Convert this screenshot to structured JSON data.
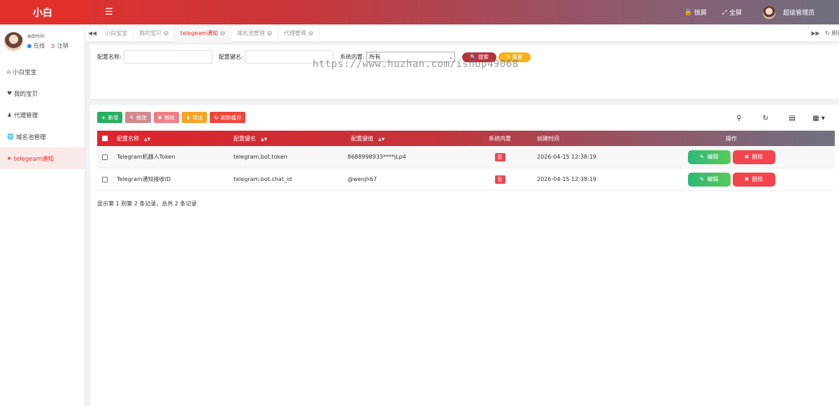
{
  "topbar": {
    "logo": "小白",
    "menu_icon": "hamburger-icon",
    "lock_label": "锁屏",
    "fullscreen_label": "全屏",
    "user_label": "超级管理员"
  },
  "sidebar": {
    "username": "admin",
    "status_online": "在线",
    "status_logout": "注销",
    "items": [
      {
        "label": "小白宝宝",
        "icon": "home-icon"
      },
      {
        "label": "我的宝贝",
        "icon": "heart-icon"
      },
      {
        "label": "代理管理",
        "icon": "user-icon"
      },
      {
        "label": "域名池管理",
        "icon": "globe-icon"
      },
      {
        "label": "telegeam通知",
        "icon": "arrow-circle-icon"
      }
    ]
  },
  "tabs": {
    "items": [
      {
        "label": "小白宝宝"
      },
      {
        "label": "我的宝贝"
      },
      {
        "label": "telegeam通知"
      },
      {
        "label": "域名池管理"
      },
      {
        "label": "代理管理"
      }
    ],
    "refresh_label": "刷新"
  },
  "search": {
    "name_label": "配置名称:",
    "key_label": "配置键名:",
    "sys_label": "系统内置:",
    "sys_value": "所有",
    "search_btn": "搜索",
    "reset_btn": "重置",
    "watermark": "https://www.huzhan.com/ishop49068"
  },
  "toolbar": {
    "add": "新增",
    "edit": "修改",
    "delete": "删除",
    "export": "导出",
    "refresh_cache": "刷新缓存"
  },
  "table": {
    "headers": {
      "name": "配置名称",
      "key": "配置键名",
      "value": "配置键值",
      "sys": "系统内置",
      "time": "创建时间",
      "op": "操作"
    },
    "rows": [
      {
        "name": "Telegram机器人Token",
        "key": "telegram.bot.token",
        "value": "8688998933****jLp4",
        "sys": "否",
        "time": "2026-04-15 12:38:19",
        "edit": "编辑",
        "delete": "删除"
      },
      {
        "name": "Telegram通知接收ID",
        "key": "telegram.bot.chat_id",
        "value": "@wenjh67",
        "sys": "否",
        "time": "2026-04-15 12:38:19",
        "edit": "编辑",
        "delete": "删除"
      }
    ],
    "pagination_info": "显示第 1 到第 2 条记录，总共 2 条记录"
  },
  "colors": {
    "brand_red": "#e2302b",
    "header_gradient_end": "#6f7183",
    "success_green": "#2eb87a",
    "danger_red": "#f2454e",
    "warning_yellow": "#f5b21a"
  }
}
